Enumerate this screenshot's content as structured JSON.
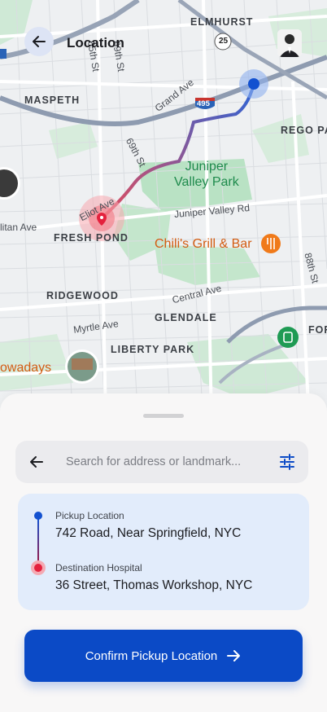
{
  "header": {
    "title": "Location"
  },
  "map": {
    "neighborhoods": [
      "ELMHURST",
      "MASPETH",
      "REGO PA",
      "FRESH POND",
      "RIDGEWOOD",
      "GLENDALE",
      "LIBERTY PARK",
      "FOR"
    ],
    "streets": [
      "Grand Ave",
      "69th St",
      "Eliot Ave",
      "Juniper Valley Rd",
      "Central Ave",
      "Myrtle Ave",
      "88th St",
      "65th St",
      "69th St",
      "litan Ave"
    ],
    "highway_shields": [
      "25",
      "495"
    ],
    "park_label": "Juniper\nValley Park",
    "poi_restaurant": "Chili's Grill & Bar",
    "poi_partial": "owadays"
  },
  "search": {
    "placeholder": "Search for address or landmark..."
  },
  "route": {
    "pickup_label": "Pickup Location",
    "pickup_value": "742 Road, Near Springfield, NYC",
    "destination_label": "Destination Hospital",
    "destination_value": "36 Street, Thomas Workshop, NYC"
  },
  "actions": {
    "confirm_label": "Confirm Pickup Location"
  },
  "colors": {
    "accent": "#0b4ac6",
    "pickup": "#1351d0",
    "destination": "#e4213d",
    "park": "#b9e2c4"
  }
}
